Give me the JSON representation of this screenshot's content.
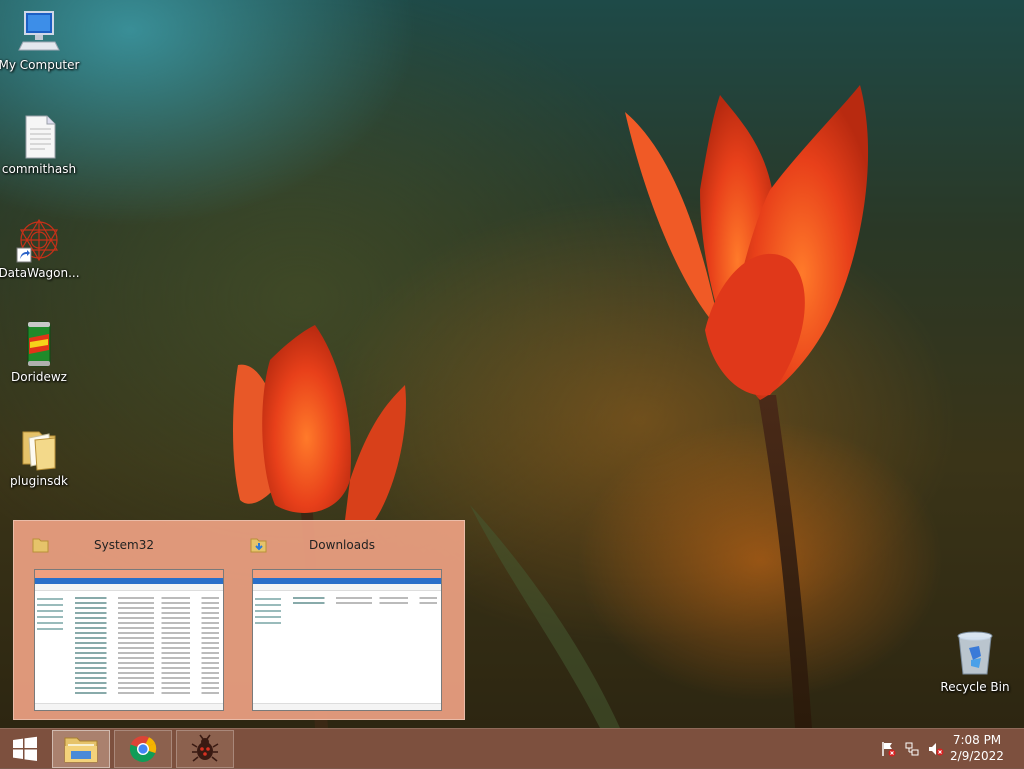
{
  "desktop": {
    "icons": [
      {
        "label": "My Computer",
        "icon": "computer-icon"
      },
      {
        "label": "commithash",
        "icon": "text-file-icon"
      },
      {
        "label": "DataWagon...",
        "icon": "datawagon-shortcut-icon"
      },
      {
        "label": "Doridewz",
        "icon": "soda-can-icon"
      },
      {
        "label": "pluginsdk",
        "icon": "folder-icon"
      },
      {
        "label": "Recycle Bin",
        "icon": "recycle-bin-icon"
      }
    ]
  },
  "thumbnail_popup": {
    "windows": [
      {
        "title": "System32",
        "icon": "folder-icon"
      },
      {
        "title": "Downloads",
        "icon": "downloads-folder-icon"
      }
    ]
  },
  "taskbar": {
    "start_icon": "windows-logo-icon",
    "pinned": [
      {
        "name": "File Explorer",
        "icon": "file-explorer-icon"
      },
      {
        "name": "Google Chrome",
        "icon": "chrome-icon"
      },
      {
        "name": "Debugger",
        "icon": "bug-icon"
      }
    ],
    "tray": {
      "icons": [
        "action-center-flag-icon",
        "network-icon",
        "volume-muted-icon"
      ],
      "time": "7:08 PM",
      "date": "2/9/2022"
    }
  },
  "colors": {
    "taskbar": "#8c5846",
    "popup": "#eca082",
    "tulip": "#e8401a"
  }
}
